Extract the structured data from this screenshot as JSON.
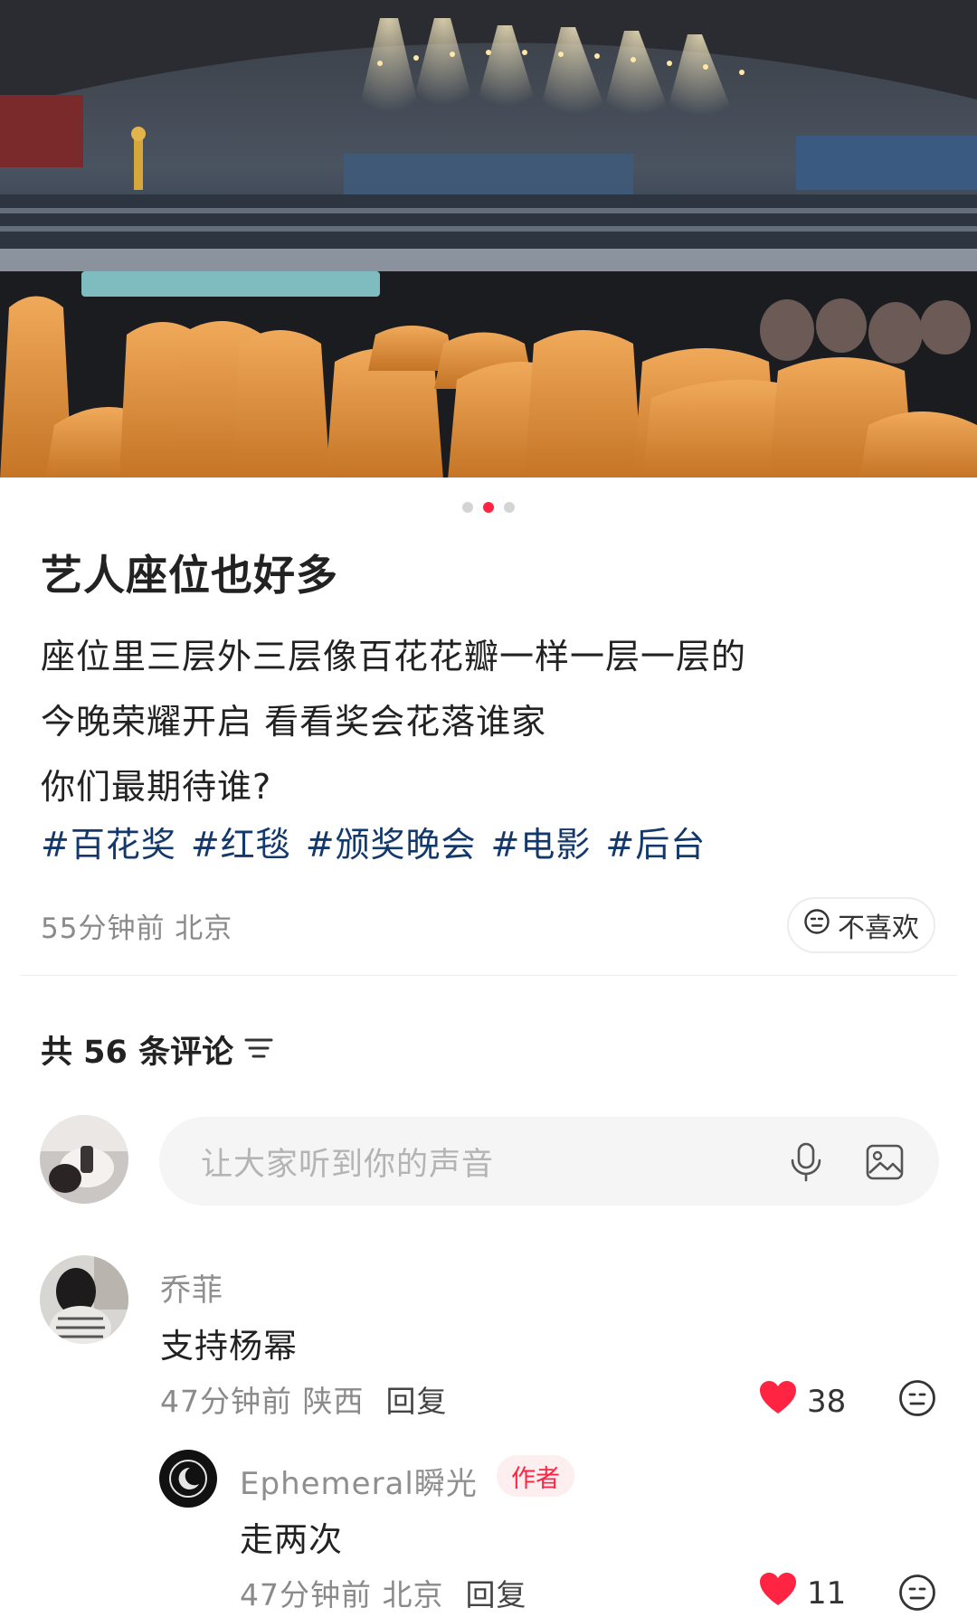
{
  "carousel": {
    "count": 3,
    "active_index": 1
  },
  "post": {
    "title": "艺人座位也好多",
    "body": [
      "座位里三层外三层像百花花瓣一样一层一层的",
      "今晚荣耀开启 看看奖会花落谁家",
      "你们最期待谁?"
    ],
    "tags": [
      "#百花奖",
      "#红毯",
      "#颁奖晚会",
      "#电影",
      "#后台"
    ],
    "meta": "55分钟前 北京",
    "dislike_label": "不喜欢"
  },
  "comments_header": {
    "label": "共 56 条评论"
  },
  "comment_input": {
    "placeholder": "让大家听到你的声音"
  },
  "comments": [
    {
      "name": "乔菲",
      "text": "支持杨幂",
      "meta": "47分钟前 陕西",
      "reply_label": "回复",
      "likes": "38",
      "replies": [
        {
          "name": "Ephemeral瞬光",
          "badge": "作者",
          "text": "走两次",
          "meta": "47分钟前 北京",
          "reply_label": "回复",
          "likes": "11"
        }
      ]
    }
  ],
  "icons": {
    "dislike": "neutral-face-icon",
    "sort": "sort-lines-icon",
    "mic": "microphone-icon",
    "image": "image-icon",
    "like": "heart-icon"
  },
  "colors": {
    "accent": "#ff2442",
    "tag": "#13386c",
    "muted": "#8a8a8a"
  }
}
